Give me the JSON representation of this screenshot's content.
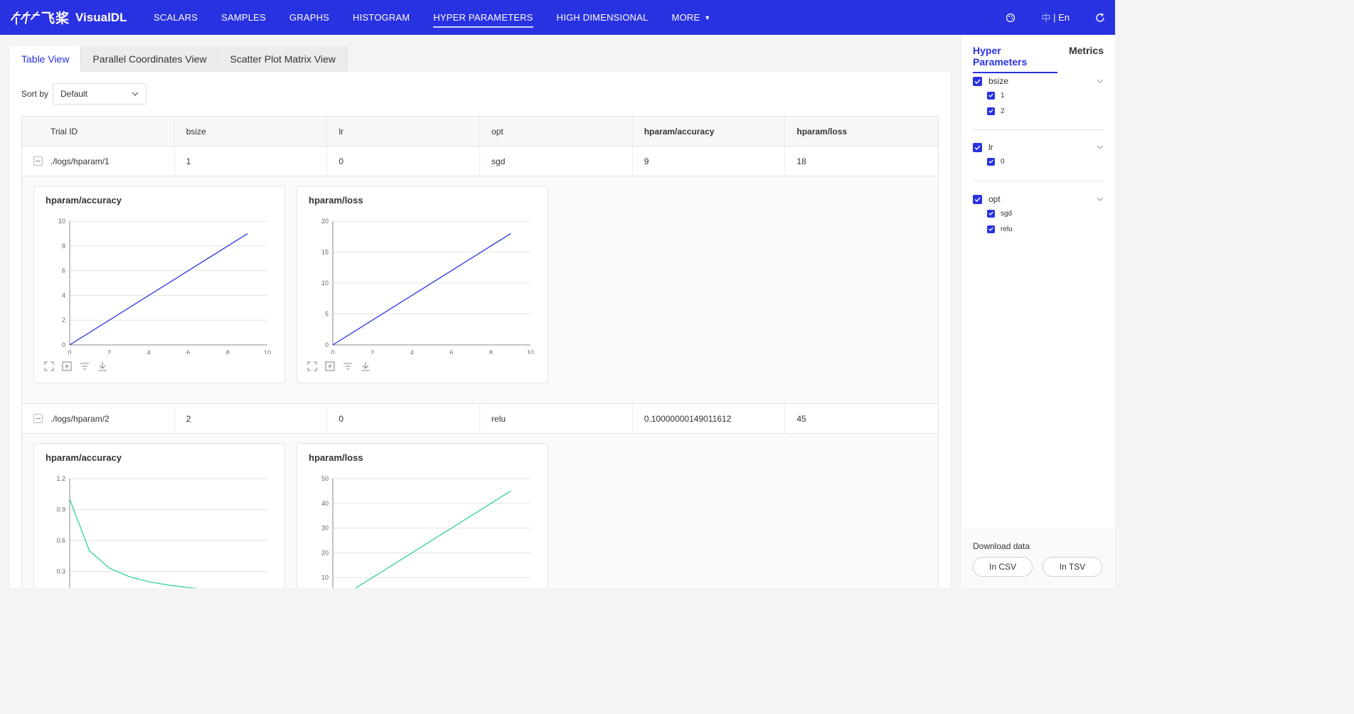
{
  "app": {
    "brand_cn": "飞桨",
    "brand": "VisualDL"
  },
  "nav": [
    {
      "label": "SCALARS"
    },
    {
      "label": "SAMPLES"
    },
    {
      "label": "GRAPHS"
    },
    {
      "label": "HISTOGRAM"
    },
    {
      "label": "HYPER PARAMETERS",
      "active": true
    },
    {
      "label": "HIGH DIMENSIONAL"
    },
    {
      "label": "MORE"
    }
  ],
  "lang": {
    "zh": "中",
    "sep": "|",
    "en": "En"
  },
  "views": [
    "Table View",
    "Parallel Coordinates View",
    "Scatter Plot Matrix View"
  ],
  "sort": {
    "label": "Sort by",
    "value": "Default"
  },
  "table": {
    "headers": [
      "Trial ID",
      "bsize",
      "lr",
      "opt",
      "hparam/accuracy",
      "hparam/loss"
    ],
    "rows": [
      [
        "./logs/hparam/1",
        "1",
        "0",
        "sgd",
        "9",
        "18"
      ],
      [
        "./logs/hparam/2",
        "2",
        "0",
        "relu",
        "0.10000000149011612",
        "45"
      ]
    ]
  },
  "colors": {
    "accent": "#2932e1",
    "series1": "#2932e1",
    "series2": "#2fd196"
  },
  "chart_data": [
    {
      "type": "line",
      "title": "hparam/accuracy",
      "trial": "./logs/hparam/1",
      "x": [
        0,
        9
      ],
      "y": [
        0,
        9
      ],
      "xlim": [
        0,
        10
      ],
      "ylim": [
        0,
        10
      ],
      "xticks": [
        0,
        2,
        4,
        6,
        8,
        10
      ],
      "yticks": [
        0,
        2,
        4,
        6,
        8,
        10
      ],
      "color": "#2932e1"
    },
    {
      "type": "line",
      "title": "hparam/loss",
      "trial": "./logs/hparam/1",
      "x": [
        0,
        9
      ],
      "y": [
        0,
        18
      ],
      "xlim": [
        0,
        10
      ],
      "ylim": [
        0,
        20
      ],
      "xticks": [
        0,
        2,
        4,
        6,
        8,
        10
      ],
      "yticks": [
        0,
        5,
        10,
        15,
        20
      ],
      "color": "#2932e1"
    },
    {
      "type": "line",
      "title": "hparam/accuracy",
      "trial": "./logs/hparam/2",
      "x": [
        0,
        1,
        2,
        3,
        4,
        5,
        6,
        7,
        8,
        9
      ],
      "y": [
        1.0,
        0.5,
        0.333,
        0.25,
        0.2,
        0.167,
        0.143,
        0.125,
        0.111,
        0.1
      ],
      "xlim": [
        0,
        10
      ],
      "ylim": [
        0,
        1.2
      ],
      "yticks": [
        0.3,
        0.6,
        0.9,
        1.2
      ],
      "color": "#2fd196"
    },
    {
      "type": "line",
      "title": "hparam/loss",
      "trial": "./logs/hparam/2",
      "x": [
        0,
        9
      ],
      "y": [
        0,
        45
      ],
      "xlim": [
        0,
        10
      ],
      "ylim": [
        0,
        50
      ],
      "yticks": [
        10,
        20,
        30,
        40,
        50
      ],
      "color": "#2fd196"
    }
  ],
  "sidebar": {
    "tabs": [
      "Hyper Parameters",
      "Metrics"
    ],
    "groups": [
      {
        "name": "bsize",
        "options": [
          "1",
          "2"
        ]
      },
      {
        "name": "lr",
        "options": [
          "0"
        ]
      },
      {
        "name": "opt",
        "options": [
          "sgd",
          "relu"
        ]
      }
    ],
    "download": {
      "label": "Download data",
      "csv": "In CSV",
      "tsv": "In TSV"
    }
  }
}
